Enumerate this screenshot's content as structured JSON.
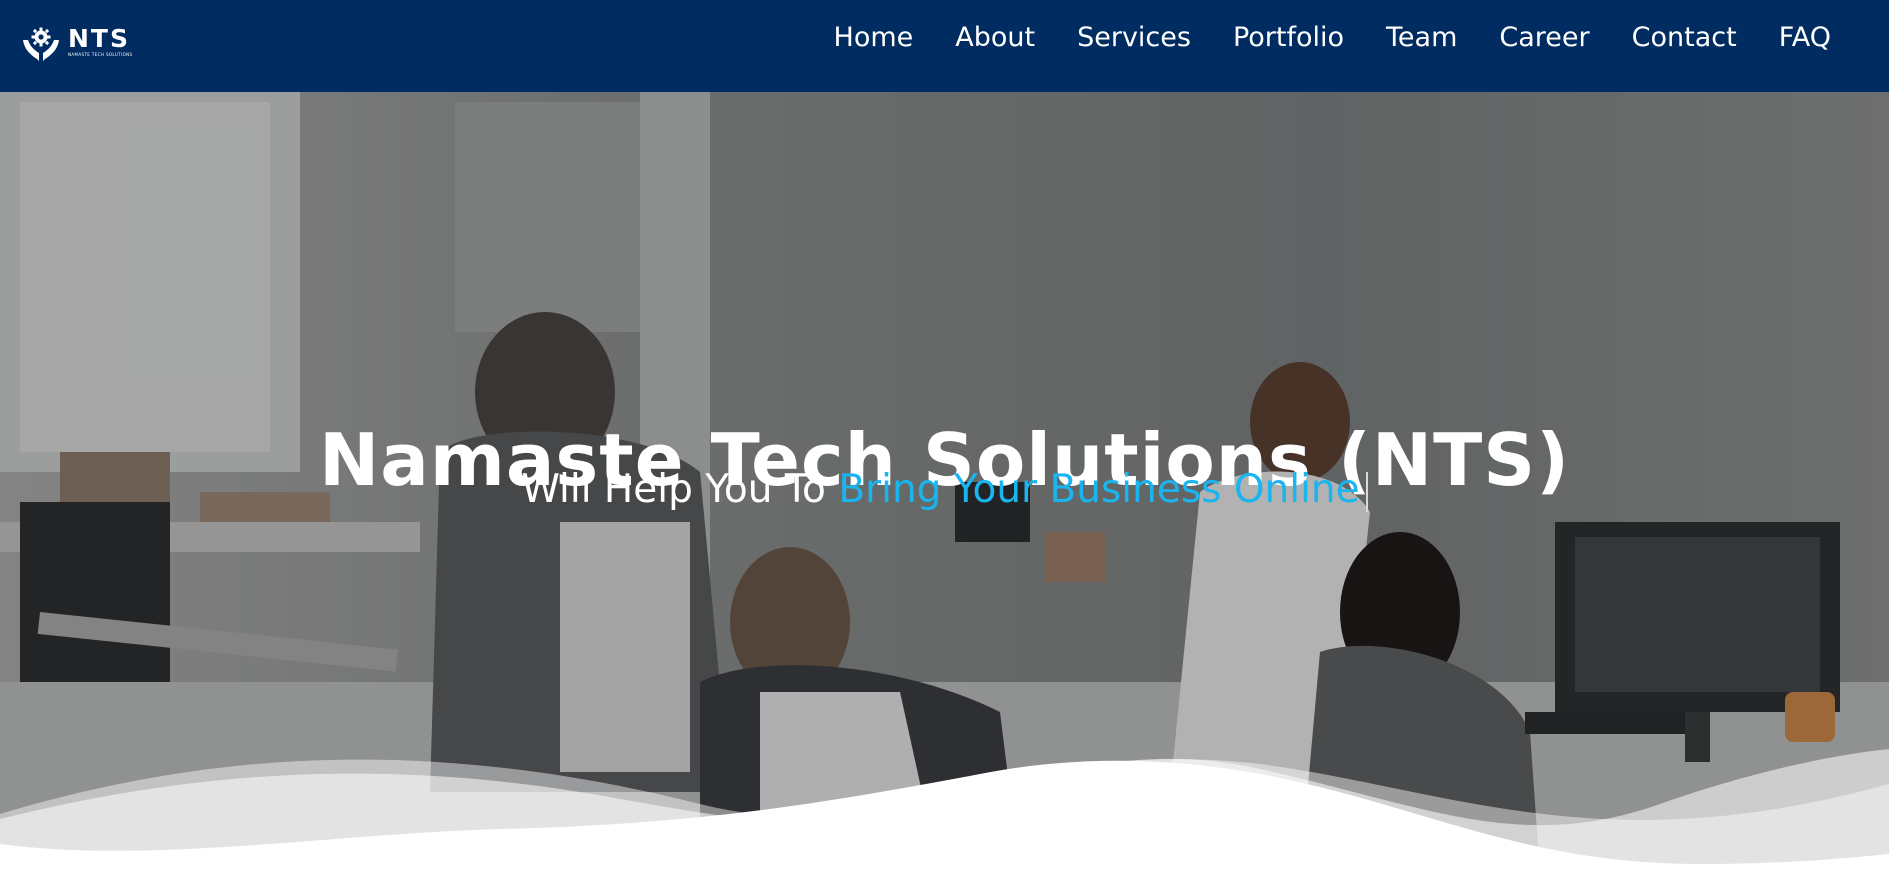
{
  "brand": {
    "name": "NTS",
    "tagline": "NAMASTE TECH SOLUTIONS",
    "logo_icon": "hands-gear-icon"
  },
  "nav": {
    "items": [
      {
        "label": "Home"
      },
      {
        "label": "About"
      },
      {
        "label": "Services"
      },
      {
        "label": "Portfolio"
      },
      {
        "label": "Team"
      },
      {
        "label": "Career"
      },
      {
        "label": "Contact"
      },
      {
        "label": "FAQ"
      }
    ]
  },
  "hero": {
    "title": "Namaste Tech Solutions (NTS)",
    "subtitle_static": "Will Help You To ",
    "subtitle_highlight": "Bring Your Business Online"
  },
  "colors": {
    "navbar_bg": "#002c62",
    "highlight": "#1ab5ef",
    "text_on_dark": "#ffffff"
  }
}
